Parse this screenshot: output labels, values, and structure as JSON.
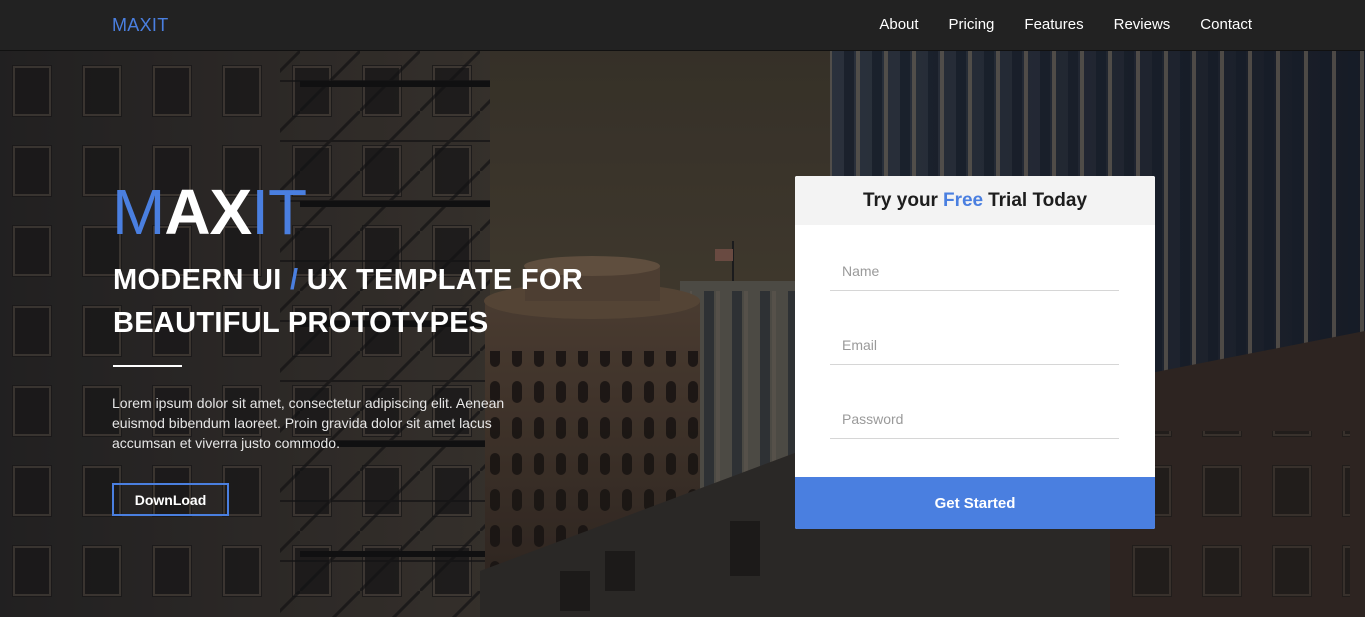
{
  "nav": {
    "brand": "MAXIT",
    "links": [
      "About",
      "Pricing",
      "Features",
      "Reviews",
      "Contact"
    ]
  },
  "hero": {
    "logo": {
      "part1": "M",
      "part2": "AX",
      "part3": "IT"
    },
    "title": {
      "part1": "MODERN UI",
      "slash": "/",
      "part2": "UX TEMPLATE FOR",
      "line2": "BEAUTIFUL PROTOTYPES"
    },
    "text": "Lorem ipsum dolor sit amet, consectetur adipiscing elit. Aenean euismod bibendum laoreet. Proin gravida dolor sit amet lacus accumsan et viverra justo commodo.",
    "download_label": "DownLoad"
  },
  "signup": {
    "heading": {
      "pre": "Try your",
      "highlight": "Free",
      "post": "Trial Today"
    },
    "name_placeholder": "Name",
    "email_placeholder": "Email",
    "password_placeholder": "Password",
    "submit_label": "Get Started"
  },
  "colors": {
    "accent": "#4a7fe0",
    "navbar": "#222222",
    "card_header": "#f3f3f3"
  }
}
